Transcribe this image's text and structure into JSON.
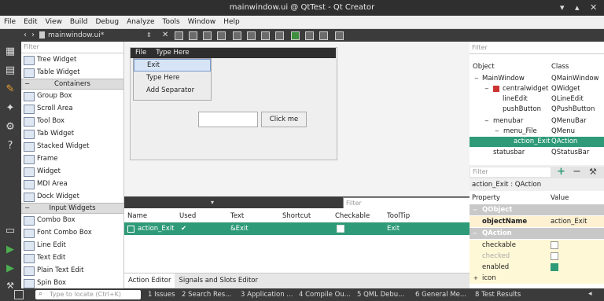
{
  "window": {
    "title": "mainwindow.ui @ QtTest - Qt Creator"
  },
  "menu": [
    "File",
    "Edit",
    "View",
    "Build",
    "Debug",
    "Analyze",
    "Tools",
    "Window",
    "Help"
  ],
  "tab": {
    "file": "mainwindow.ui*"
  },
  "widget_box": {
    "filter_placeholder": "Filter",
    "items_top": [
      "Tree Widget",
      "Table Widget"
    ],
    "category_containers": "Containers",
    "containers": [
      "Group Box",
      "Scroll Area",
      "Tool Box",
      "Tab Widget",
      "Stacked Widget",
      "Frame",
      "Widget",
      "MDI Area",
      "Dock Widget"
    ],
    "category_input": "Input Widgets",
    "inputs": [
      "Combo Box",
      "Font Combo Box",
      "Line Edit",
      "Text Edit",
      "Plain Text Edit",
      "Spin Box"
    ]
  },
  "form": {
    "menu": [
      "File",
      "Type Here"
    ],
    "dropdown": [
      "Exit",
      "Type Here",
      "Add Separator"
    ],
    "button": "Click me"
  },
  "action_editor": {
    "filter_placeholder": "Filter",
    "headers": [
      "Name",
      "Used",
      "Text",
      "Shortcut",
      "Checkable",
      "ToolTip"
    ],
    "row": {
      "name": "action_Exit",
      "text": "&Exit",
      "tooltip": "Exit"
    },
    "tabs": [
      "Action Editor",
      "Signals and Slots Editor"
    ]
  },
  "object_inspector": {
    "filter_placeholder": "Filter",
    "headers": [
      "Object",
      "Class"
    ],
    "rows": [
      {
        "object": "MainWindow",
        "class": "QMainWindow"
      },
      {
        "object": "centralwidget",
        "class": "QWidget"
      },
      {
        "object": "lineEdit",
        "class": "QLineEdit"
      },
      {
        "object": "pushButton",
        "class": "QPushButton"
      },
      {
        "object": "menubar",
        "class": "QMenuBar"
      },
      {
        "object": "menu_File",
        "class": "QMenu"
      },
      {
        "object": "action_Exit",
        "class": "QAction"
      },
      {
        "object": "statusbar",
        "class": "QStatusBar"
      }
    ]
  },
  "property_editor": {
    "filter_placeholder": "Filter",
    "object_label": "action_Exit : QAction",
    "headers": [
      "Property",
      "Value"
    ],
    "cat_qobject": "QObject",
    "objectname": {
      "name": "objectName",
      "value": "action_Exit"
    },
    "cat_qaction": "QAction",
    "props": [
      "checkable",
      "checked",
      "enabled",
      "icon"
    ]
  },
  "statusbar": {
    "locate_placeholder": "Type to locate (Ctrl+K)",
    "tabs": [
      "1 Issues",
      "2 Search Res...",
      "3 Application ...",
      "4 Compile Ou...",
      "5 QML Debu...",
      "6 General Me...",
      "8 Test Results"
    ]
  }
}
